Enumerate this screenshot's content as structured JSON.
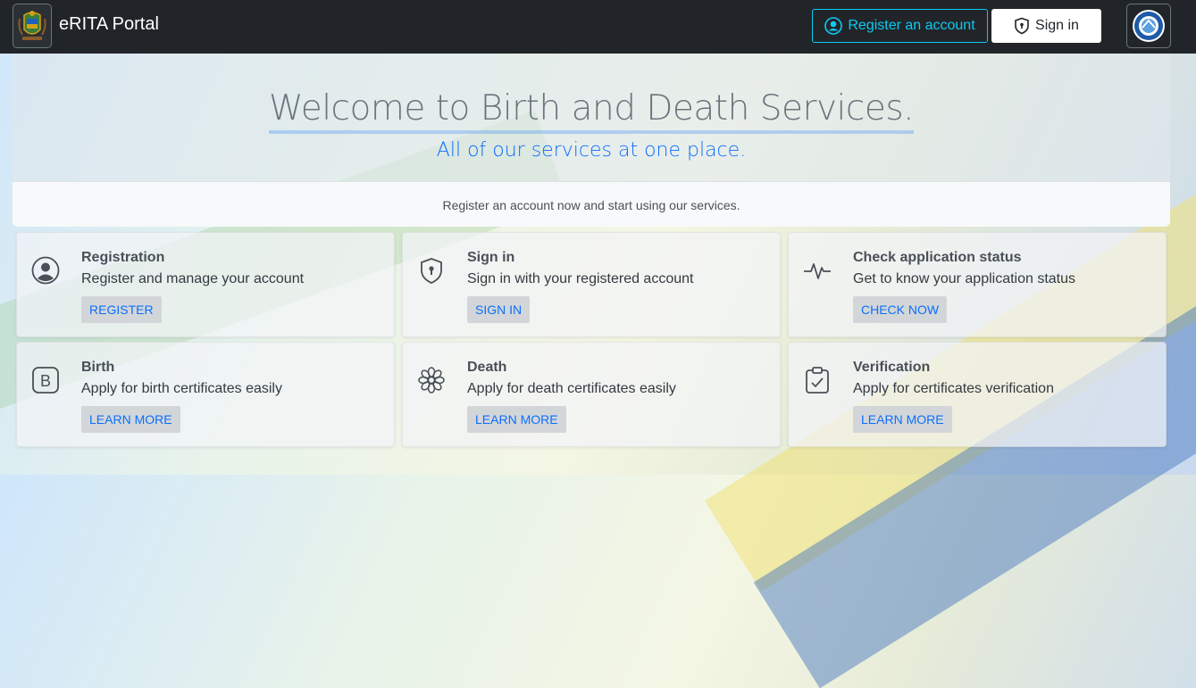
{
  "navbar": {
    "brand": "eRITA Portal",
    "register_label": "Register an account",
    "signin_label": "Sign in",
    "accent": "#0dcaf0",
    "background": "#212529"
  },
  "hero": {
    "title": "Welcome to Birth and Death Services.",
    "subtitle": "All of our services at one place.",
    "footer": "Register an account now and start using our services."
  },
  "cards": [
    {
      "icon": "person-circle-icon",
      "title": "Registration",
      "description": "Register and manage your account",
      "button": "REGISTER"
    },
    {
      "icon": "shield-lock-icon",
      "title": "Sign in",
      "description": "Sign in with your registered account",
      "button": "SIGN IN"
    },
    {
      "icon": "activity-icon",
      "title": "Check application status",
      "description": "Get to know your application status",
      "button": "CHECK NOW"
    },
    {
      "icon": "letter-b-icon",
      "title": "Birth",
      "description": "Apply for birth certificates easily",
      "button": "LEARN MORE"
    },
    {
      "icon": "flower-icon",
      "title": "Death",
      "description": "Apply for death certificates easily",
      "button": "LEARN MORE"
    },
    {
      "icon": "clipboard-check-icon",
      "title": "Verification",
      "description": "Apply for certificates verification",
      "button": "LEARN MORE"
    }
  ],
  "colors": {
    "link_blue": "#0d6efd",
    "button_bg": "#d3d6d9"
  }
}
